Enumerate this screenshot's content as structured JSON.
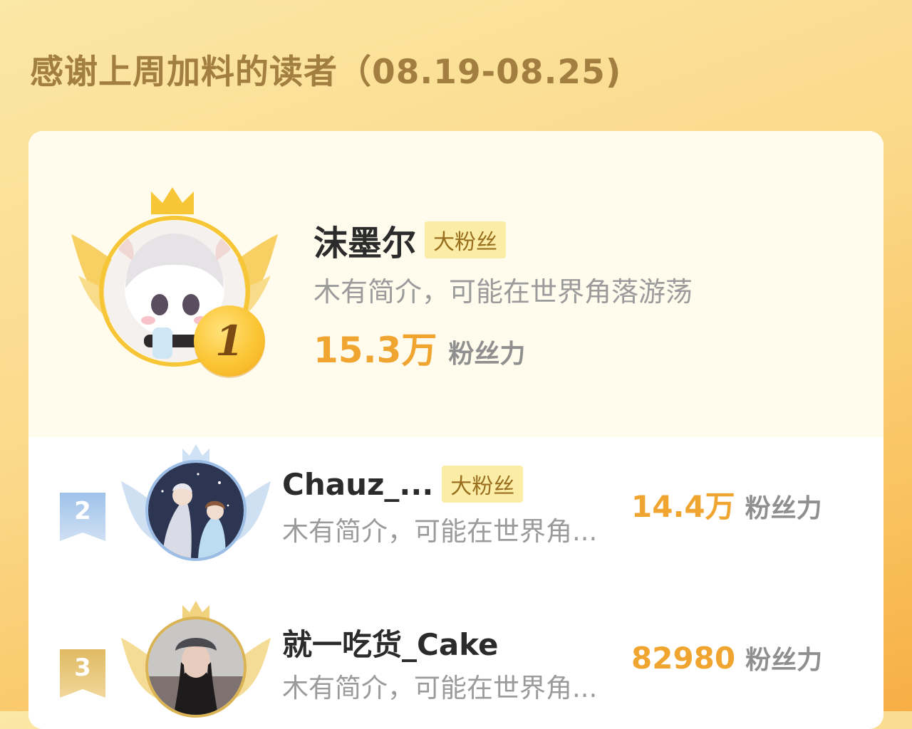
{
  "header": {
    "title": "感谢上周加料的读者（08.19-08.25)"
  },
  "first": {
    "rank": "1",
    "name": "沫墨尔",
    "tag": "大粉丝",
    "intro": "木有简介，可能在世界角落游荡",
    "score": "15.3万",
    "score_unit": "粉丝力"
  },
  "rows": [
    {
      "rank": "2",
      "name": "Chauz_...",
      "tag": "大粉丝",
      "intro": "木有简介，可能在世界角...",
      "score": "14.4万",
      "score_unit": "粉丝力"
    },
    {
      "rank": "3",
      "name": "就一吃货_Cake",
      "intro": "木有简介，可能在世界角...",
      "score": "82980",
      "score_unit": "粉丝力"
    }
  ],
  "colors": {
    "gold_rank": "#fbc534",
    "silver_rank": "#a9c8ec",
    "bronze_rank": "#e6c36e",
    "score": "#f0a530"
  }
}
